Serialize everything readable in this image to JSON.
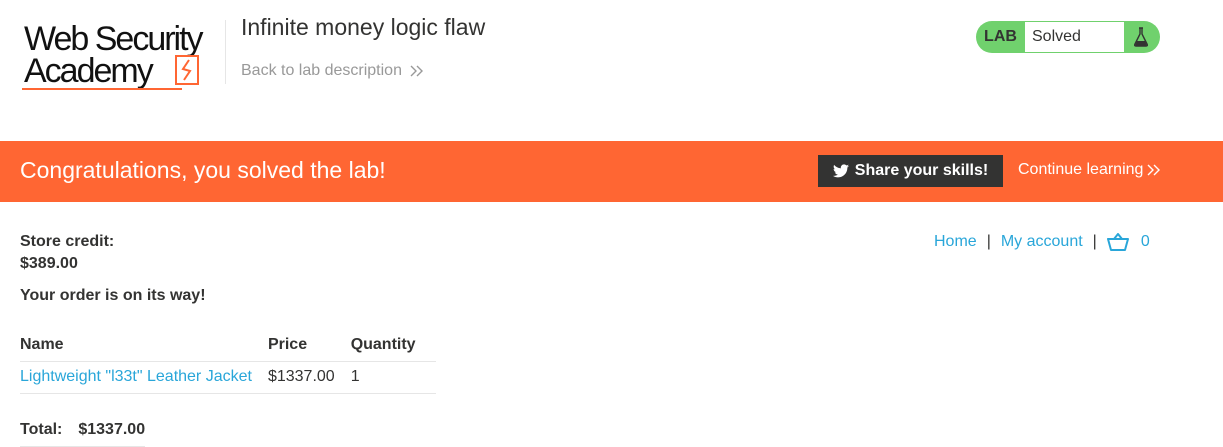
{
  "header": {
    "logo_line1": "Web Security",
    "logo_line2": "Academy",
    "lab_title": "Infinite money logic flaw",
    "back_link": "Back to lab description",
    "lab_badge": "LAB",
    "lab_status": "Solved"
  },
  "banner": {
    "message": "Congratulations, you solved the lab!",
    "share_button": "Share your skills!",
    "continue_link": "Continue learning"
  },
  "nav": {
    "home": "Home",
    "my_account": "My account",
    "separator": "|",
    "cart_count": "0"
  },
  "account": {
    "store_credit_label": "Store credit:",
    "store_credit_value": "$389.00",
    "order_message": "Your order is on its way!"
  },
  "order_table": {
    "headers": [
      "Name",
      "Price",
      "Quantity"
    ],
    "rows": [
      {
        "name": "Lightweight \"l33t\" Leather Jacket",
        "price": "$1337.00",
        "quantity": "1"
      }
    ],
    "total_label": "Total:",
    "total_value": "$1337.00"
  },
  "colors": {
    "accent_orange": "#ff6633",
    "link_blue": "#29a6d9",
    "solved_green": "#70d16d",
    "dark": "#333332"
  },
  "icons": {
    "back": "chevron-double-right-icon",
    "flask": "flask-icon",
    "twitter": "twitter-icon",
    "cart": "cart-icon"
  }
}
